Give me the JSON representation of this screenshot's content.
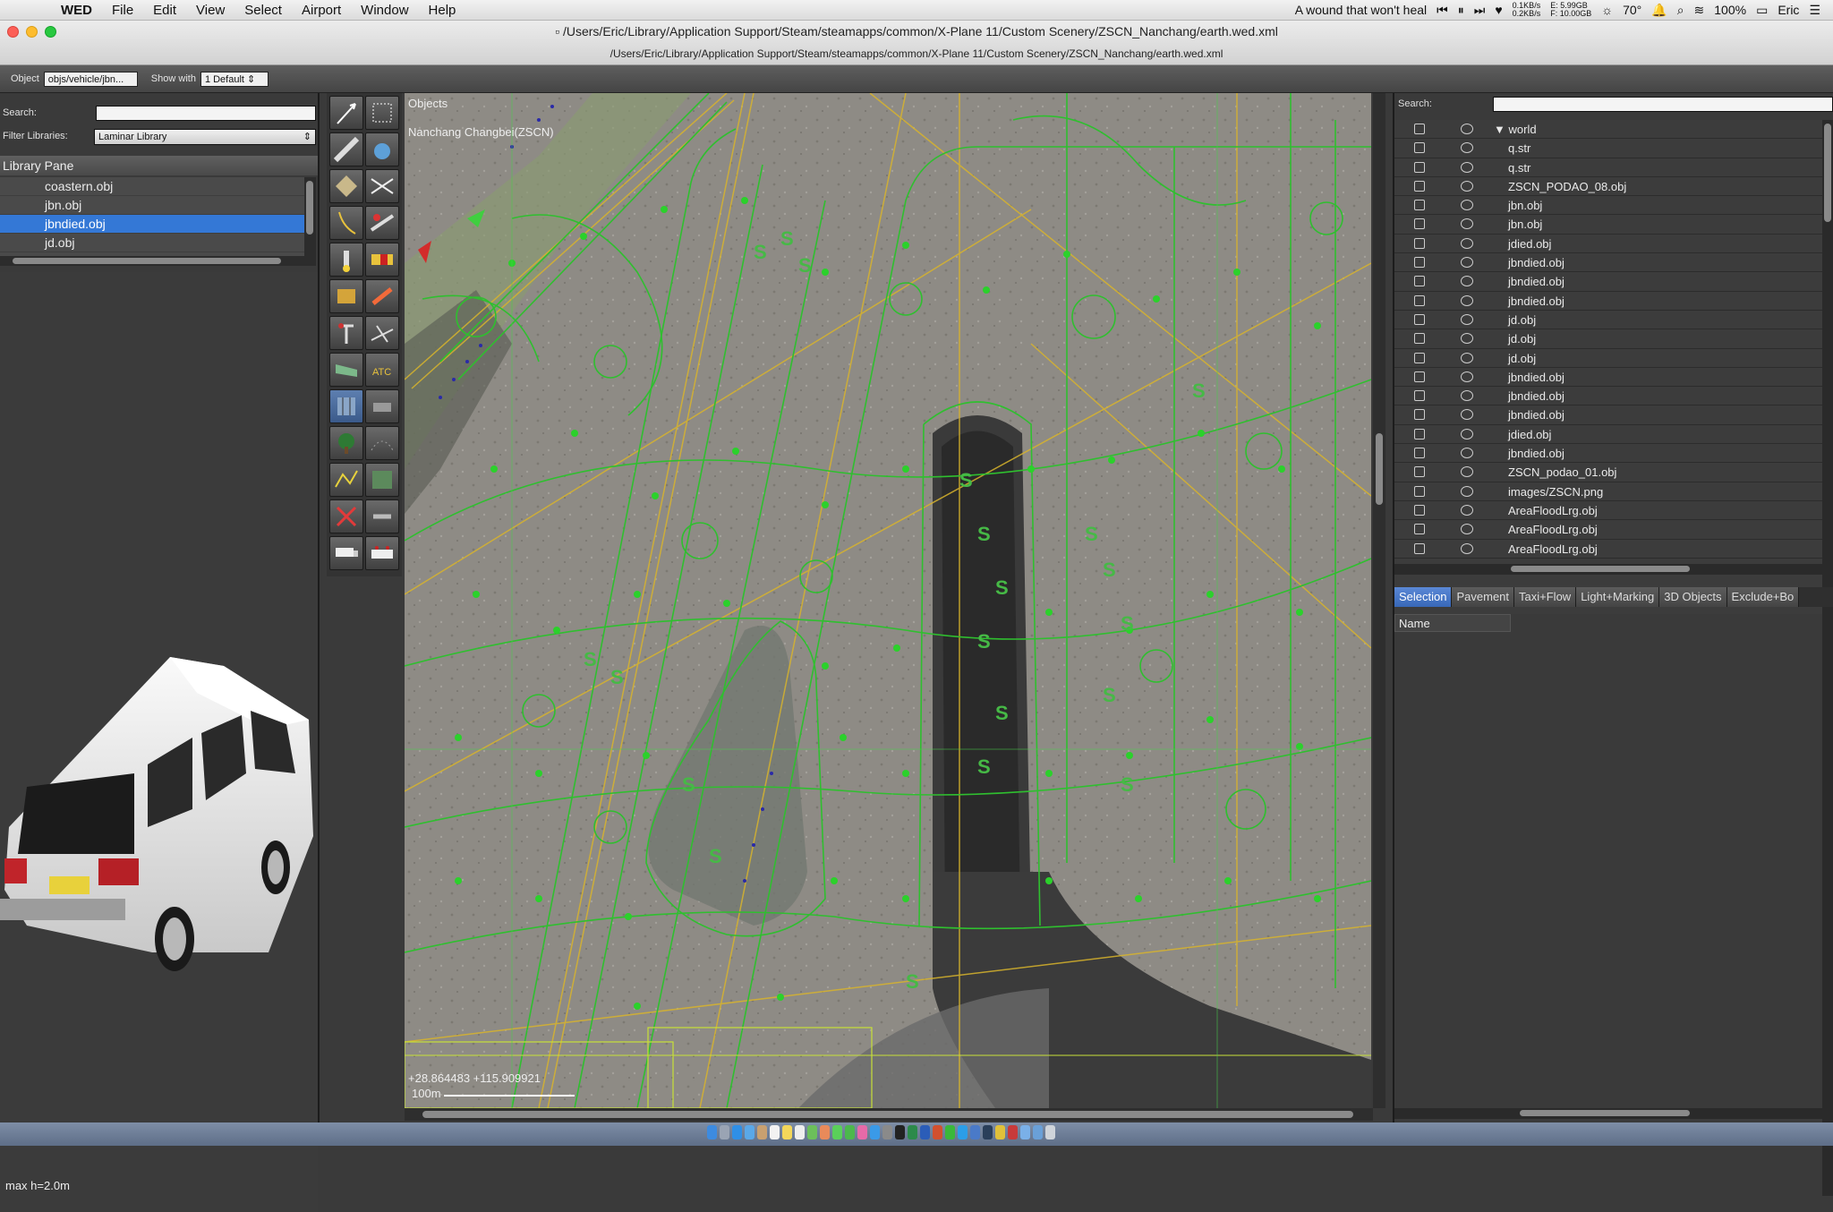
{
  "menubar": {
    "app": "WED",
    "items": [
      "File",
      "Edit",
      "View",
      "Select",
      "Airport",
      "Window",
      "Help"
    ],
    "now_playing": "A wound that won't heal",
    "net_up": "0.1KB/s",
    "net_down": "0.2KB/s",
    "mem_e": "E: 5.99GB",
    "mem_f": "F: 10.00GB",
    "temp": "70°",
    "battery": "100%",
    "user": "Eric"
  },
  "window": {
    "title": "/Users/Eric/Library/Application Support/Steam/steamapps/common/X-Plane 11/Custom Scenery/ZSCN_Nanchang/earth.wed.xml",
    "subtitle": "/Users/Eric/Library/Application Support/Steam/steamapps/common/X-Plane 11/Custom Scenery/ZSCN_Nanchang/earth.wed.xml"
  },
  "toolbar": {
    "object_label": "Object",
    "object_value": "objs/vehicle/jbn...",
    "show_with_label": "Show with",
    "show_with_value": "1 Default"
  },
  "library": {
    "search_label": "Search:",
    "filter_label": "Filter Libraries:",
    "filter_value": "Laminar Library",
    "pane_title": "Library Pane",
    "items": [
      "coastern.obj",
      "jbn.obj",
      "jbndied.obj",
      "jd.obj"
    ],
    "selected": "jbndied.obj",
    "max_h": "max h=2.0m"
  },
  "map": {
    "mode_label": "Objects",
    "airport_label": "Nanchang Changbei(ZSCN)",
    "coords": "+28.864483 +115.909921",
    "scale": "100m"
  },
  "hierarchy": {
    "search_label": "Search:",
    "root": "world",
    "items": [
      "q.str",
      "q.str",
      "ZSCN_PODAO_08.obj",
      "jbn.obj",
      "jbn.obj",
      "jdied.obj",
      "jbndied.obj",
      "jbndied.obj",
      "jbndied.obj",
      "jd.obj",
      "jd.obj",
      "jd.obj",
      "jbndied.obj",
      "jbndied.obj",
      "jbndied.obj",
      "jdied.obj",
      "jbndied.obj",
      "ZSCN_podao_01.obj",
      "images/ZSCN.png",
      "AreaFloodLrg.obj",
      "AreaFloodLrg.obj",
      "AreaFloodLrg.obj"
    ]
  },
  "tabs": [
    "Selection",
    "Pavement",
    "Taxi+Flow",
    "Light+Marking",
    "3D Objects",
    "Exclude+Bo"
  ],
  "properties": {
    "name_header": "Name"
  },
  "colors": {
    "accent": "#3478d6",
    "taxi_line": "#2fbf2f",
    "centerline": "#d8b42c"
  }
}
